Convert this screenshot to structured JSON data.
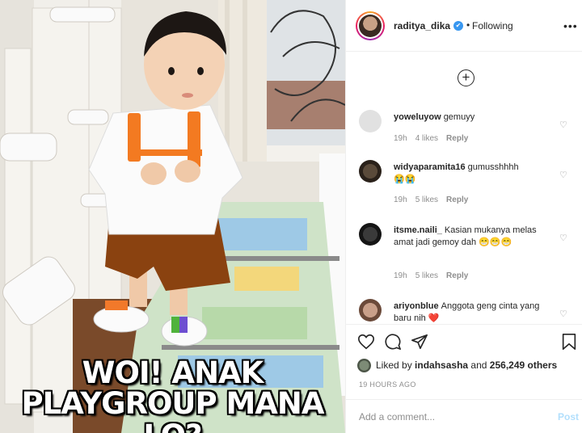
{
  "photo": {
    "caption_line1": "WOI! ANAK",
    "caption_line2": "PLAYGROUP MANA LO?"
  },
  "header": {
    "username": "raditya_dika",
    "verified_icon": "✔",
    "separator": "•",
    "follow_status": "Following",
    "more_icon": "•••"
  },
  "add_icon": "+",
  "comments": [
    {
      "username": "yoweluyow",
      "text": "gemuyy",
      "time": "19h",
      "likes": "4 likes",
      "reply": "Reply"
    },
    {
      "username": "widyaparamita16",
      "text": "gumusshhhh",
      "emoji": "😭😭",
      "time": "19h",
      "likes": "5 likes",
      "reply": "Reply"
    },
    {
      "username": "itsme.naili_",
      "text": "Kasian mukanya melas amat jadi gemoy dah",
      "emoji": "😁😁😁",
      "time": "19h",
      "likes": "5 likes",
      "reply": "Reply"
    },
    {
      "username": "ariyonblue",
      "text": "Anggota geng cinta yang baru nih",
      "emoji": "❤️"
    }
  ],
  "likes": {
    "prefix": "Liked by ",
    "user": "indahsasha",
    "middle": " and ",
    "count": "256,249 others"
  },
  "timestamp": "19 HOURS AGO",
  "add_comment": {
    "placeholder": "Add a comment...",
    "post_label": "Post"
  },
  "colors": {
    "verified": "#3897f0",
    "post_disabled": "#b2dffc",
    "meta": "#8e8e8e"
  }
}
